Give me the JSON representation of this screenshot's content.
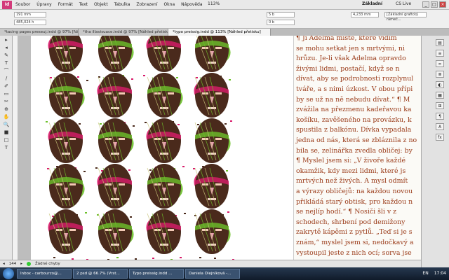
{
  "menubar": {
    "app_logo": "Id",
    "items": [
      "Soubor",
      "Úpravy",
      "Formát",
      "Text",
      "Objekt",
      "Tabulka",
      "Zobrazení",
      "Okna",
      "Nápověda"
    ],
    "zoom": "113%",
    "workspace": "Základní",
    "cs_live": "CS Live"
  },
  "control": {
    "x_value": "191 mm",
    "y_value": "485,024 h",
    "size1": "5 b",
    "size2": "0 b",
    "stroke": "4,233 mm",
    "frame_style": "[Základní grafický rámeč..."
  },
  "tabs": [
    {
      "label": "*tacing pages preseuj.indd @ 97% [Náhled přetisku]",
      "active": false
    },
    {
      "label": "*tha illavisuace.indd @ 97% [Náhled přetisku]",
      "active": false
    },
    {
      "label": "*typo preissig.indd @ 113% [Náhled přetisku]",
      "active": true
    }
  ],
  "tools": [
    "▸",
    "◂",
    "✎",
    "T",
    "⌒",
    "/",
    "✐",
    "▭",
    "✂",
    "⊕",
    "✋",
    "🔍",
    "■",
    "□",
    "T"
  ],
  "text_lines": [
    "¶ Ji Adelma miste, ktere vidim",
    "se mohu setkat jen s mrtvými, ni",
    "hrůzu. Je-li však Adelma opravdo",
    "živými lidmi, postačí, když se n",
    "dívat, aby se podrobnosti rozplynul",
    "tváře, a s nimi úzkost. V obou přípi",
    "by se už na ně nebudu dívat.“ ¶ M",
    "zvážila na přezmenu kadeřavou ka",
    "košíku, zavěšeného na provázku, k",
    "spustila z balkónu. Dívka vypadala",
    "jedna od nás, která se zbláznila z no",
    "bila se, zelinářka zvedla obličej: by",
    "¶ Myslel jsem si: „V živoře každé",
    "okamžik, kdy mezi lidmi, které js",
    "mrtvých než živých. A mysl odmít",
    "a výrazy obličejů: na každou novou",
    "přikládá starý obtisk, pro každou n",
    "se nejlíp hodí.“ ¶ Nosiči šli v z",
    "schodech, shrbení pod demižony",
    "zakrytě kápěmi z pytlů. „Teď si je s",
    "znám,“ myslel jsem si, nedočkavý a",
    "vystoupil jeste z nich ocí; sorva jse"
  ],
  "status": {
    "page": "144",
    "errors": "Žádné chyby"
  },
  "taskbar": {
    "items": [
      "Inbox - carbourzo@...",
      "2 psd @ 66.7% (Vrst...",
      "Typo preissig.indd ...",
      "Daniela Olejníková -..."
    ],
    "lang": "EN",
    "time": "17:04"
  },
  "colors": {
    "text": "#9b3c1a",
    "mask_dark": "#4a2a1c",
    "mask_pink": "#d81b6a",
    "mask_green": "#6cc12a"
  },
  "icons": {
    "page_nav": "page-navigation-icon",
    "errors": "green-status-dot-icon"
  }
}
